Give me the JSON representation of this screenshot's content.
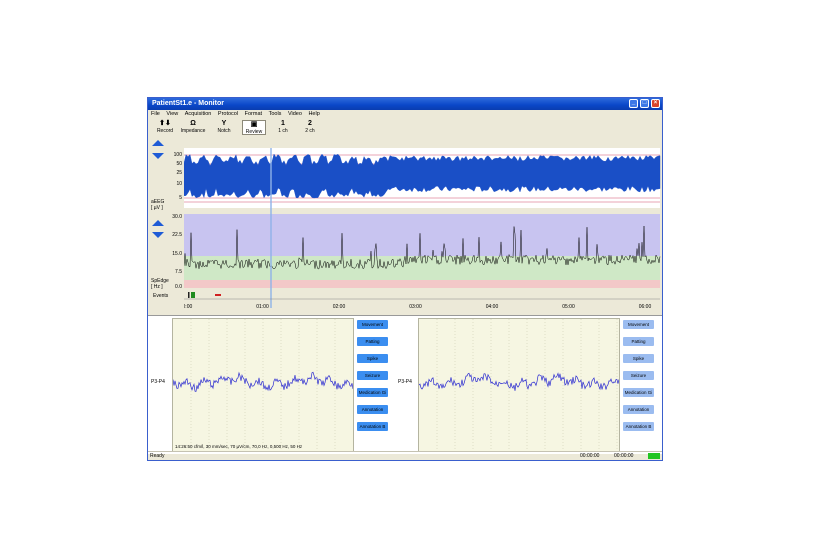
{
  "window": {
    "title": "PatientSt1.e - Monitor"
  },
  "menu": [
    "File",
    "View",
    "Acquisition",
    "Protocol",
    "Format",
    "Tools",
    "Video",
    "Help"
  ],
  "toolbar": [
    {
      "icon": "record-icon",
      "glyph": "⬆⬇",
      "label": "Record"
    },
    {
      "icon": "impedance-icon",
      "glyph": "Ω",
      "label": "Impedance"
    },
    {
      "icon": "notch-icon",
      "glyph": "Y",
      "label": "Notch"
    },
    {
      "icon": "review-icon",
      "glyph": "▣",
      "label": "Review",
      "active": true
    },
    {
      "icon": "one-channel-icon",
      "glyph": "1",
      "label": "1 ch"
    },
    {
      "icon": "two-channel-icon",
      "glyph": "2",
      "label": "2 ch"
    }
  ],
  "aeeg": {
    "unit_label": "aEEG",
    "unit_sub": "[ µV ]",
    "ticks": [
      "100",
      "50",
      "25",
      "10",
      "5"
    ]
  },
  "spedge": {
    "unit_label": "SpEdge",
    "unit_sub": "[ Hz ]",
    "ticks": [
      "30.0",
      "22.5",
      "15.0",
      "7.5",
      "0.0"
    ]
  },
  "events_label": "Events",
  "time_ticks": [
    "00:00",
    "01:00",
    "02:00",
    "03:00",
    "04:00",
    "05:00",
    "06:00"
  ],
  "channel_label": "P3-P4",
  "markers": [
    "Movement",
    "Patting",
    "Spike",
    "Seizure",
    "Medication Gi",
    "Annotation",
    "Annotation B"
  ],
  "info_line": "14:26:50 cfm/l, 30 mm/sec, 70 µV/cm, 70,0 Hz, 0,500 Hz, 50 Hz",
  "status": {
    "text": "Ready",
    "time1": "00:00:00",
    "time2": "00:00:00"
  },
  "colors": {
    "aeeg_trace": "#1a4fc6",
    "spedge_band_top": "#c8c4f0",
    "spedge_band_mid": "#cfe8c6",
    "spedge_band_low": "#f3c8c8",
    "marker_left": "#3b8ef0",
    "marker_right": "#9bbcf0",
    "eeg_trace": "#2a2ad0"
  }
}
